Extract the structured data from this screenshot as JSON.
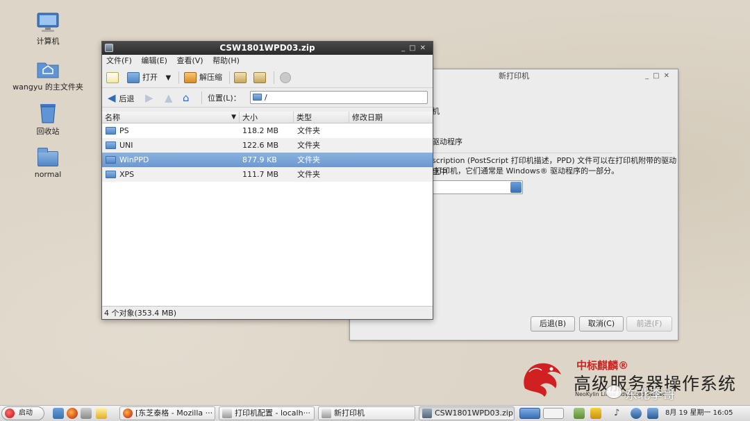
{
  "desktop": {
    "icons": [
      {
        "label": "计算机"
      },
      {
        "label": "wangyu 的主文件夹"
      },
      {
        "label": "回收站"
      },
      {
        "label": "normal"
      }
    ]
  },
  "new_printer_window": {
    "title": "新打印机",
    "frag_1": "机",
    "frag_2": "驱动程序",
    "desc_line1": "scription (PostScript 打印机描述，PPD) 文件可以在打印机附带的驱动盘中",
    "desc_line2": "打印机，它们通常是 Windows® 驱动程序的一部分。",
    "back_button": "后退(B)",
    "cancel_button": "取消(C)",
    "forward_button": "前进(F)"
  },
  "archive_window": {
    "title": "CSW1801WPD03.zip",
    "menu": [
      "文件(F)",
      "编辑(E)",
      "查看(V)",
      "帮助(H)"
    ],
    "toolbar": {
      "open_label": "打开",
      "extract_label": "解压缩"
    },
    "nav": {
      "back_label": "后退",
      "location_label": "位置(L)：",
      "location_value": "/"
    },
    "columns": [
      "名称",
      "大小",
      "类型",
      "修改日期"
    ],
    "rows": [
      {
        "name": "PS",
        "size": "118.2 MB",
        "type": "文件夹",
        "date": ""
      },
      {
        "name": "UNI",
        "size": "122.6 MB",
        "type": "文件夹",
        "date": ""
      },
      {
        "name": "WinPPD",
        "size": "877.9 KB",
        "type": "文件夹",
        "date": ""
      },
      {
        "name": "XPS",
        "size": "111.7 MB",
        "type": "文件夹",
        "date": ""
      }
    ],
    "selected_row": "WinPPD",
    "status": "4 个对象(353.4 MB)"
  },
  "branding": {
    "top": "中标麒麟®",
    "main": "高级服务器操作系统",
    "sub": "NeoKylin Linux Advanced Server",
    "watermark": "东北李哥"
  },
  "taskbar": {
    "start_label": "启动",
    "tasks": [
      {
        "label": "[东芝泰格 - Mozilla ···"
      },
      {
        "label": "打印机配置 - localh···"
      },
      {
        "label": "新打印机"
      },
      {
        "label": "CSW1801WPD03.zip"
      }
    ],
    "clock": "8月 19 星期一 16:05"
  },
  "colors": {
    "desktop_bg": "#ddd5c7",
    "selection": "#7aa4d8",
    "brand_red": "#d02020"
  }
}
